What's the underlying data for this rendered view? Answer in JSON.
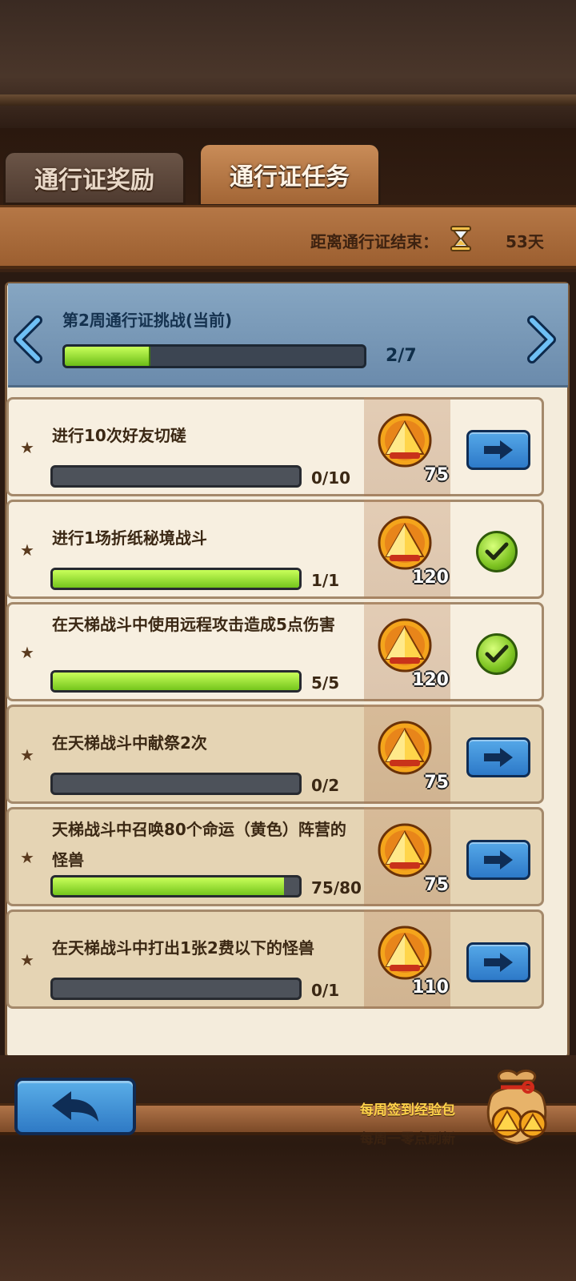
{
  "tabs": {
    "rewards": "通行证奖励",
    "tasks": "通行证任务"
  },
  "countdown": {
    "label": "距离通行证结束：",
    "value": "53天",
    "icon": "hourglass-icon"
  },
  "week": {
    "title": "第2周通行证挑战(当前)",
    "progress_text": "2/7",
    "progress": 0.2857
  },
  "tasks": [
    {
      "title": "进行10次好友切磋",
      "count": "0/10",
      "progress": 0.0,
      "reward": "75",
      "state": "go",
      "dim": false
    },
    {
      "title": "进行1场折纸秘境战斗",
      "count": "1/1",
      "progress": 1.0,
      "reward": "120",
      "state": "done",
      "dim": false
    },
    {
      "title": "在天梯战斗中使用远程攻击造成5点伤害",
      "count": "5/5",
      "progress": 1.0,
      "reward": "120",
      "state": "done",
      "dim": false
    },
    {
      "title": "在天梯战斗中献祭2次",
      "count": "0/2",
      "progress": 0.0,
      "reward": "75",
      "state": "go",
      "dim": true
    },
    {
      "title": "天梯战斗中召唤80个命运（黄色）阵营的怪兽",
      "count": "75/80",
      "progress": 0.9375,
      "reward": "75",
      "state": "go",
      "dim": true
    },
    {
      "title": "在天梯战斗中打出1张2费以下的怪兽",
      "count": "0/1",
      "progress": 0.0,
      "reward": "110",
      "state": "go",
      "dim": true
    }
  ],
  "footer": {
    "weekly_pack": "每周签到经验包",
    "weekly_refresh": "每周一零点刷新"
  },
  "colors": {
    "accent_blue": "#2d79c8",
    "progress_green": "#74c51c",
    "wood": "#b57746"
  }
}
